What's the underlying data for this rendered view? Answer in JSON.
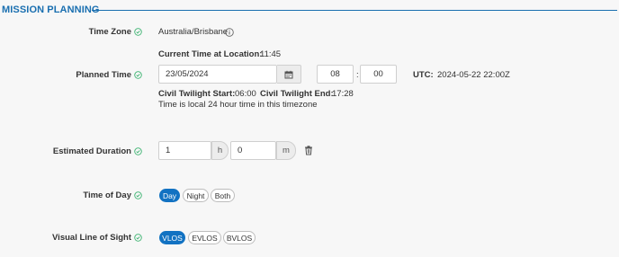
{
  "section": {
    "title": "MISSION PLANNING"
  },
  "colors": {
    "accent": "#1a6fb0",
    "active_pill": "#1272c2",
    "check": "#3cb371"
  },
  "time_zone": {
    "label": "Time Zone",
    "value": "Australia/Brisbane",
    "info_icon": "info-icon"
  },
  "current_time": {
    "label": "Current Time at Location:",
    "value": "11:45"
  },
  "planned_time": {
    "label": "Planned Time",
    "date": "23/05/2024",
    "hour": "08",
    "separator": ":",
    "minute": "00",
    "utc_label": "UTC:",
    "utc_value": "2024-05-22 22:00Z",
    "twilight_start_label": "Civil Twilight Start:",
    "twilight_start_value": "06:00",
    "twilight_end_label": "Civil Twilight End:",
    "twilight_end_value": "17:28",
    "note": "Time is local 24 hour time in this timezone"
  },
  "estimated_duration": {
    "label": "Estimated Duration",
    "hours_value": "1",
    "hours_unit": "h",
    "minutes_value": "0",
    "minutes_unit": "m"
  },
  "time_of_day": {
    "label": "Time of Day",
    "options": [
      "Day",
      "Night",
      "Both"
    ],
    "selected": "Day"
  },
  "visual_line_of_sight": {
    "label": "Visual Line of Sight",
    "options": [
      "VLOS",
      "EVLOS",
      "BVLOS"
    ],
    "selected": "VLOS"
  }
}
